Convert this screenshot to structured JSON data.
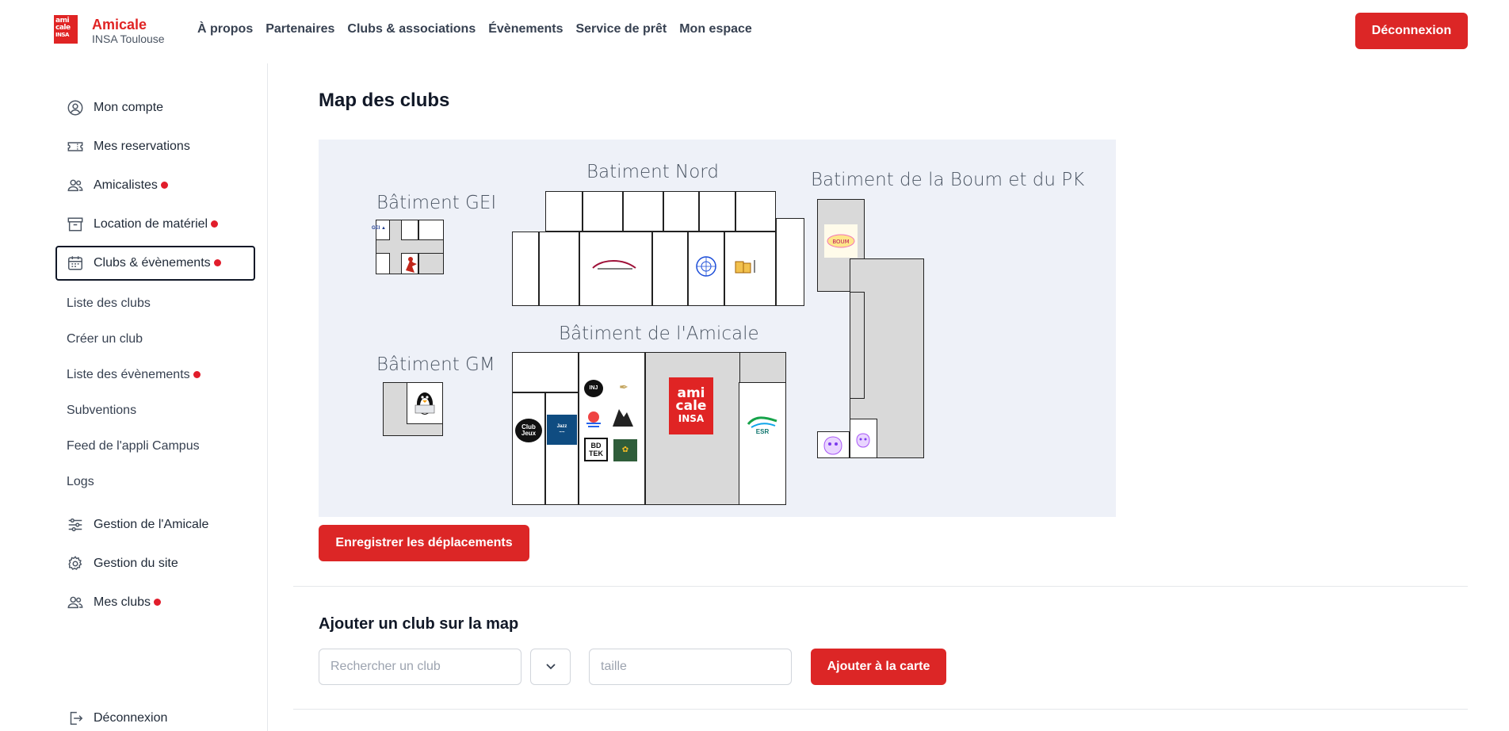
{
  "header": {
    "logo_text": "ami cale INSA",
    "brand_name": "Amicale",
    "brand_sub": "INSA Toulouse",
    "nav": [
      "À propos",
      "Partenaires",
      "Clubs & associations",
      "Évènements",
      "Service de prêt",
      "Mon espace"
    ],
    "logout_label": "Déconnexion"
  },
  "sidebar": {
    "items": [
      {
        "label": "Mon compte",
        "icon": "user-circle-icon",
        "dot": false
      },
      {
        "label": "Mes reservations",
        "icon": "ticket-icon",
        "dot": false
      },
      {
        "label": "Amicalistes",
        "icon": "users-icon",
        "dot": true
      },
      {
        "label": "Location de matériel",
        "icon": "archive-box-icon",
        "dot": true
      },
      {
        "label": "Clubs & évènements",
        "icon": "calendar-icon",
        "dot": true,
        "active": true
      }
    ],
    "sub_items": [
      {
        "label": "Liste des clubs",
        "dot": false
      },
      {
        "label": "Créer un club",
        "dot": false
      },
      {
        "label": "Liste des évènements",
        "dot": true
      },
      {
        "label": "Subventions",
        "dot": false
      },
      {
        "label": "Feed de l'appli Campus",
        "dot": false
      },
      {
        "label": "Logs",
        "dot": false
      }
    ],
    "bottom_items": [
      {
        "label": "Gestion de l'Amicale",
        "icon": "sliders-icon",
        "dot": false
      },
      {
        "label": "Gestion du site",
        "icon": "gear-icon",
        "dot": false
      },
      {
        "label": "Mes clubs",
        "icon": "users-icon",
        "dot": true
      }
    ],
    "logout_label": "Déconnexion"
  },
  "main": {
    "title": "Map des clubs",
    "map": {
      "buildings": [
        "Bâtiment GEI",
        "Batiment Nord",
        "Batiment de la Boum et du PK",
        "Bâtiment GM",
        "Bâtiment de l'Amicale"
      ],
      "amicale_logo": "ami cale INSA",
      "esr_label": "ESR"
    },
    "save_label": "Enregistrer les déplacements",
    "add_section": {
      "title": "Ajouter un club sur la map",
      "search_placeholder": "Rechercher un club",
      "size_placeholder": "taille",
      "add_label": "Ajouter à la carte"
    }
  },
  "colors": {
    "accent": "#dc2626",
    "notification_dot": "#e11d2b",
    "map_background": "#eef1f8",
    "room_gray": "#d9d9d9"
  }
}
